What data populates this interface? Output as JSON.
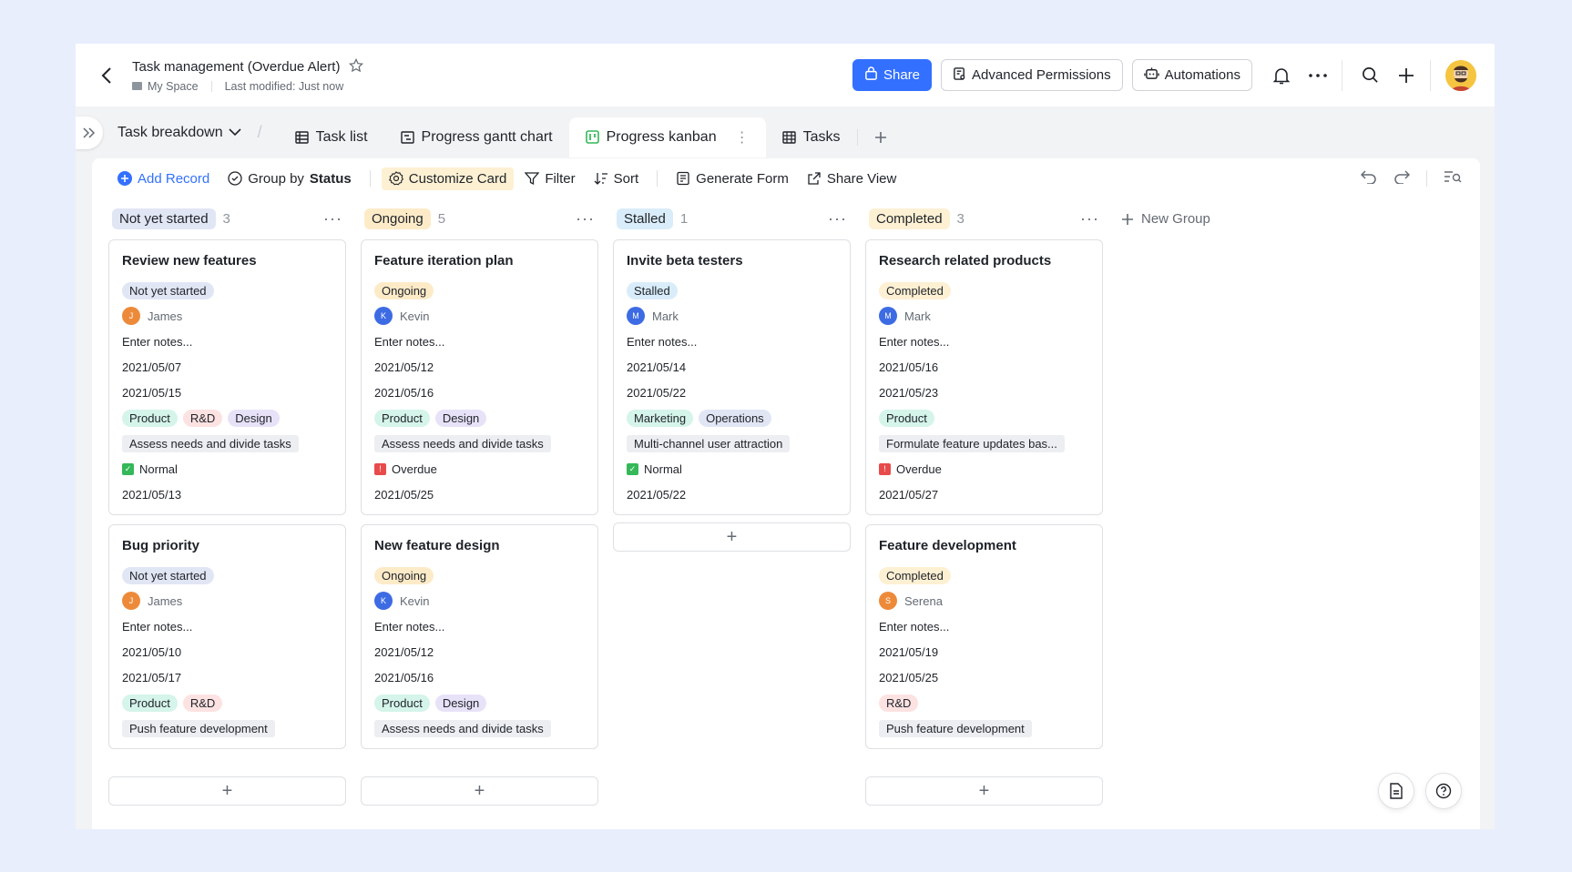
{
  "header": {
    "title": "Task management (Overdue Alert)",
    "location": "My Space",
    "modified": "Last modified: Just now",
    "share_label": "Share",
    "permissions_label": "Advanced Permissions",
    "automations_label": "Automations"
  },
  "tabs": {
    "dropdown_label": "Task breakdown",
    "items": [
      {
        "label": "Task list",
        "icon": "grid-table-icon"
      },
      {
        "label": "Progress gantt chart",
        "icon": "gantt-icon"
      },
      {
        "label": "Progress kanban",
        "icon": "kanban-icon",
        "active": true
      },
      {
        "label": "Tasks",
        "icon": "form-grid-icon"
      }
    ]
  },
  "toolbar": {
    "add_record": "Add Record",
    "group_by_prefix": "Group by",
    "group_by_field": "Status",
    "customize_card": "Customize Card",
    "filter": "Filter",
    "sort": "Sort",
    "generate_form": "Generate Form",
    "share_view": "Share View"
  },
  "new_group_label": "New Group",
  "colors": {
    "accent": "#3370ff",
    "not_started_bg": "#e1e6f5",
    "ongoing_bg": "#fdebc8",
    "stalled_bg": "#d9ecf9",
    "completed_bg": "#fdf0d3"
  },
  "columns": [
    {
      "name": "Not yet started",
      "count": "3",
      "cards": [
        {
          "title": "Review new features",
          "status": "Not yet started",
          "owner": "James",
          "initial": "J",
          "notes": "Enter notes...",
          "start": "2021/05/07",
          "end": "2021/05/15",
          "tags": [
            "Product",
            "R&D",
            "Design"
          ],
          "stage": "Assess needs and divide tasks",
          "alert": "Normal",
          "alert_type": "normal",
          "deadline": "2021/05/13"
        },
        {
          "title": "Bug priority",
          "status": "Not yet started",
          "owner": "James",
          "initial": "J",
          "notes": "Enter notes...",
          "start": "2021/05/10",
          "end": "2021/05/17",
          "tags": [
            "Product",
            "R&D"
          ],
          "stage": "Push feature development"
        }
      ]
    },
    {
      "name": "Ongoing",
      "count": "5",
      "cards": [
        {
          "title": "Feature iteration plan",
          "status": "Ongoing",
          "owner": "Kevin",
          "initial": "K",
          "notes": "Enter notes...",
          "start": "2021/05/12",
          "end": "2021/05/16",
          "tags": [
            "Product",
            "Design"
          ],
          "stage": "Assess needs and divide tasks",
          "alert": "Overdue",
          "alert_type": "overdue",
          "deadline": "2021/05/25"
        },
        {
          "title": "New feature design",
          "status": "Ongoing",
          "owner": "Kevin",
          "initial": "K",
          "notes": "Enter notes...",
          "start": "2021/05/12",
          "end": "2021/05/16",
          "tags": [
            "Product",
            "Design"
          ],
          "stage": "Assess needs and divide tasks"
        }
      ]
    },
    {
      "name": "Stalled",
      "count": "1",
      "cards": [
        {
          "title": "Invite beta testers",
          "status": "Stalled",
          "owner": "Mark",
          "initial": "M",
          "notes": "Enter notes...",
          "start": "2021/05/14",
          "end": "2021/05/22",
          "tags": [
            "Marketing",
            "Operations"
          ],
          "stage": "Multi-channel user attraction",
          "alert": "Normal",
          "alert_type": "normal",
          "deadline": "2021/05/22"
        }
      ]
    },
    {
      "name": "Completed",
      "count": "3",
      "cards": [
        {
          "title": "Research related products",
          "status": "Completed",
          "owner": "Mark",
          "initial": "M",
          "notes": "Enter notes...",
          "start": "2021/05/16",
          "end": "2021/05/23",
          "tags": [
            "Product"
          ],
          "stage": "Formulate feature updates bas...",
          "alert": "Overdue",
          "alert_type": "overdue",
          "deadline": "2021/05/27"
        },
        {
          "title": "Feature development",
          "status": "Completed",
          "owner": "Serena",
          "initial": "S",
          "notes": "Enter notes...",
          "start": "2021/05/19",
          "end": "2021/05/25",
          "tags": [
            "R&D"
          ],
          "stage": "Push feature development"
        }
      ]
    }
  ]
}
